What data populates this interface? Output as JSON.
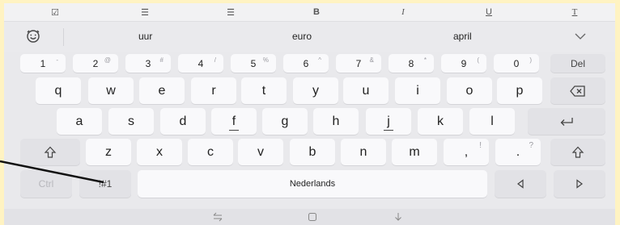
{
  "toolbar": {
    "items": [
      {
        "icon": "checklist-icon",
        "glyph": "☑"
      },
      {
        "icon": "bullet-list-icon",
        "glyph": "☰"
      },
      {
        "icon": "numbered-list-icon",
        "glyph": "☰"
      },
      {
        "icon": "bold-icon",
        "glyph": "B"
      },
      {
        "icon": "italic-icon",
        "glyph": "I"
      },
      {
        "icon": "underline-icon",
        "glyph": "U"
      },
      {
        "icon": "text-format-icon",
        "glyph": "T"
      }
    ]
  },
  "suggestions": {
    "words": [
      "uur",
      "euro",
      "april"
    ]
  },
  "keyboard": {
    "number_row": [
      {
        "main": "1",
        "sup": "-"
      },
      {
        "main": "2",
        "sup": "@"
      },
      {
        "main": "3",
        "sup": "#"
      },
      {
        "main": "4",
        "sup": "/"
      },
      {
        "main": "5",
        "sup": "%"
      },
      {
        "main": "6",
        "sup": "^"
      },
      {
        "main": "7",
        "sup": "&"
      },
      {
        "main": "8",
        "sup": "*"
      },
      {
        "main": "9",
        "sup": "("
      },
      {
        "main": "0",
        "sup": ")"
      }
    ],
    "del_label": "Del",
    "row_q": [
      "q",
      "w",
      "e",
      "r",
      "t",
      "y",
      "u",
      "i",
      "o",
      "p"
    ],
    "row_a": [
      "a",
      "s",
      "d",
      "f",
      "g",
      "h",
      "j",
      "k",
      "l"
    ],
    "row_z": [
      "z",
      "x",
      "c",
      "v",
      "b",
      "n",
      "m"
    ],
    "comma": {
      "main": ",",
      "sup": "!"
    },
    "period": {
      "main": ".",
      "sup": "?"
    },
    "ctrl_label": "Ctrl",
    "symbols_label": "!#1",
    "space_label": "Nederlands"
  },
  "colors": {
    "frame": "#fff3c2",
    "background": "#e9e9ec",
    "key": "#f9f9fb",
    "key_gray": "#e2e2e6"
  }
}
